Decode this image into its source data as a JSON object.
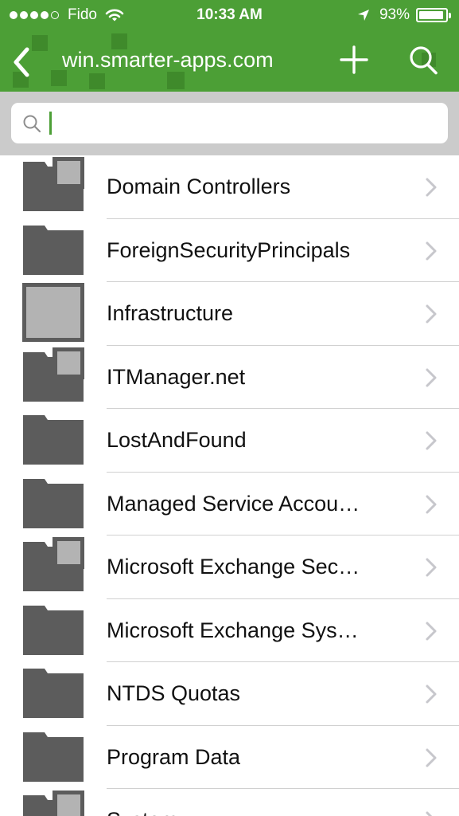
{
  "status_bar": {
    "carrier": "Fido",
    "time": "10:33 AM",
    "battery_percent": "93%",
    "battery_level": 0.93,
    "signal_bars": 4,
    "signal_total": 5
  },
  "nav": {
    "title": "win.smarter-apps.com",
    "back_icon": "chevron-left-icon",
    "add_icon": "plus-icon",
    "search_icon": "search-icon"
  },
  "search": {
    "value": "",
    "placeholder": ""
  },
  "items": [
    {
      "label": "Domain Controllers",
      "icon": "container-folder-icon"
    },
    {
      "label": "ForeignSecurityPrincipals",
      "icon": "folder-icon"
    },
    {
      "label": "Infrastructure",
      "icon": "object-icon"
    },
    {
      "label": "ITManager.net",
      "icon": "container-folder-icon"
    },
    {
      "label": "LostAndFound",
      "icon": "folder-icon"
    },
    {
      "label": "Managed Service Accou…",
      "icon": "folder-icon"
    },
    {
      "label": "Microsoft Exchange Sec…",
      "icon": "container-folder-icon"
    },
    {
      "label": "Microsoft Exchange Sys…",
      "icon": "folder-icon"
    },
    {
      "label": "NTDS Quotas",
      "icon": "folder-icon"
    },
    {
      "label": "Program Data",
      "icon": "folder-icon"
    },
    {
      "label": "System",
      "icon": "container-folder-icon"
    }
  ],
  "colors": {
    "accent": "#4c9f36",
    "accent_dark": "#3f8a2b",
    "icon_dark": "#5c5c5c",
    "icon_light": "#b3b3b3",
    "search_bg": "#cbcbcb"
  }
}
